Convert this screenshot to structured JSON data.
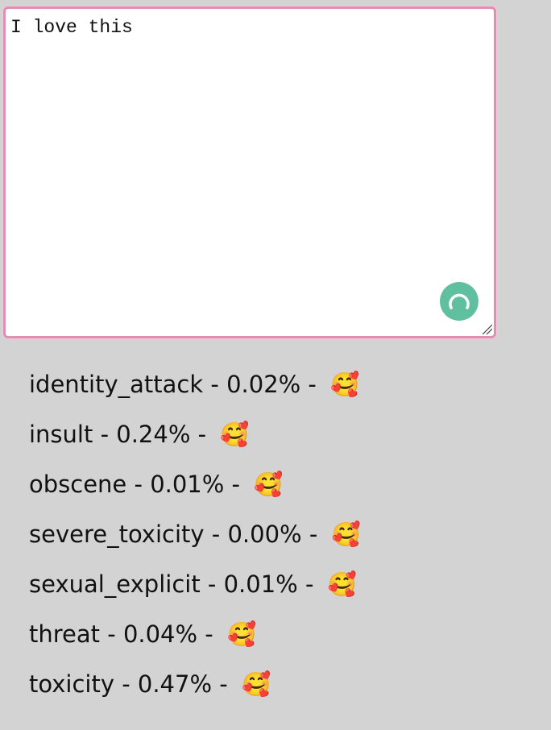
{
  "editor": {
    "value": "I love this"
  },
  "results": [
    {
      "label": "identity_attack",
      "score": "0.02%",
      "separator": " - ",
      "emoji": "🥰"
    },
    {
      "label": "insult",
      "score": "0.24%",
      "separator": " - ",
      "emoji": "🥰"
    },
    {
      "label": "obscene",
      "score": "0.01%",
      "separator": " - ",
      "emoji": "🥰"
    },
    {
      "label": "severe_toxicity",
      "score": "0.00%",
      "separator": " - ",
      "emoji": "🥰"
    },
    {
      "label": "sexual_explicit",
      "score": "0.01%",
      "separator": " - ",
      "emoji": "🥰"
    },
    {
      "label": "threat",
      "score": "0.04%",
      "separator": " - ",
      "emoji": "🥰"
    },
    {
      "label": "toxicity",
      "score": "0.47%",
      "separator": " - ",
      "emoji": "🥰"
    }
  ],
  "colors": {
    "background": "#d3d3d3",
    "editor_border": "#e08fb3",
    "status_indicator": "#5fbf9e"
  },
  "icons": {
    "status": "loading-spinner-icon",
    "resize": "resize-grip-icon"
  }
}
